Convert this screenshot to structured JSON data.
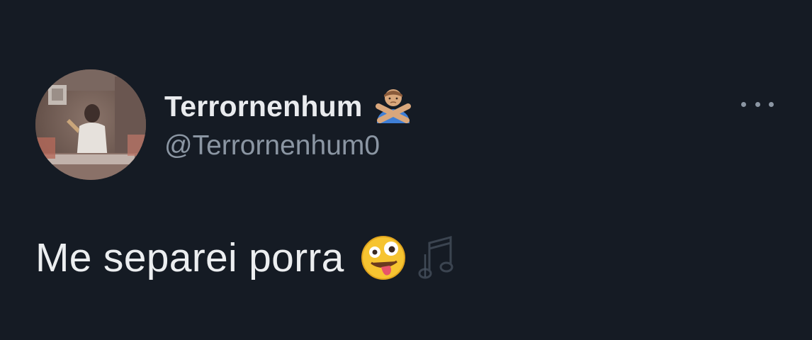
{
  "tweet": {
    "display_name": "Terrornenhum",
    "handle": "@Terrornenhum0",
    "text": "Me separei porra",
    "name_emoji": "person-gesturing-no-icon",
    "text_emojis": [
      "zany-face-icon",
      "musical-notes-icon"
    ]
  },
  "colors": {
    "background": "#151b24",
    "primary_text": "#e7e9ea",
    "secondary_text": "#8b96a3"
  }
}
